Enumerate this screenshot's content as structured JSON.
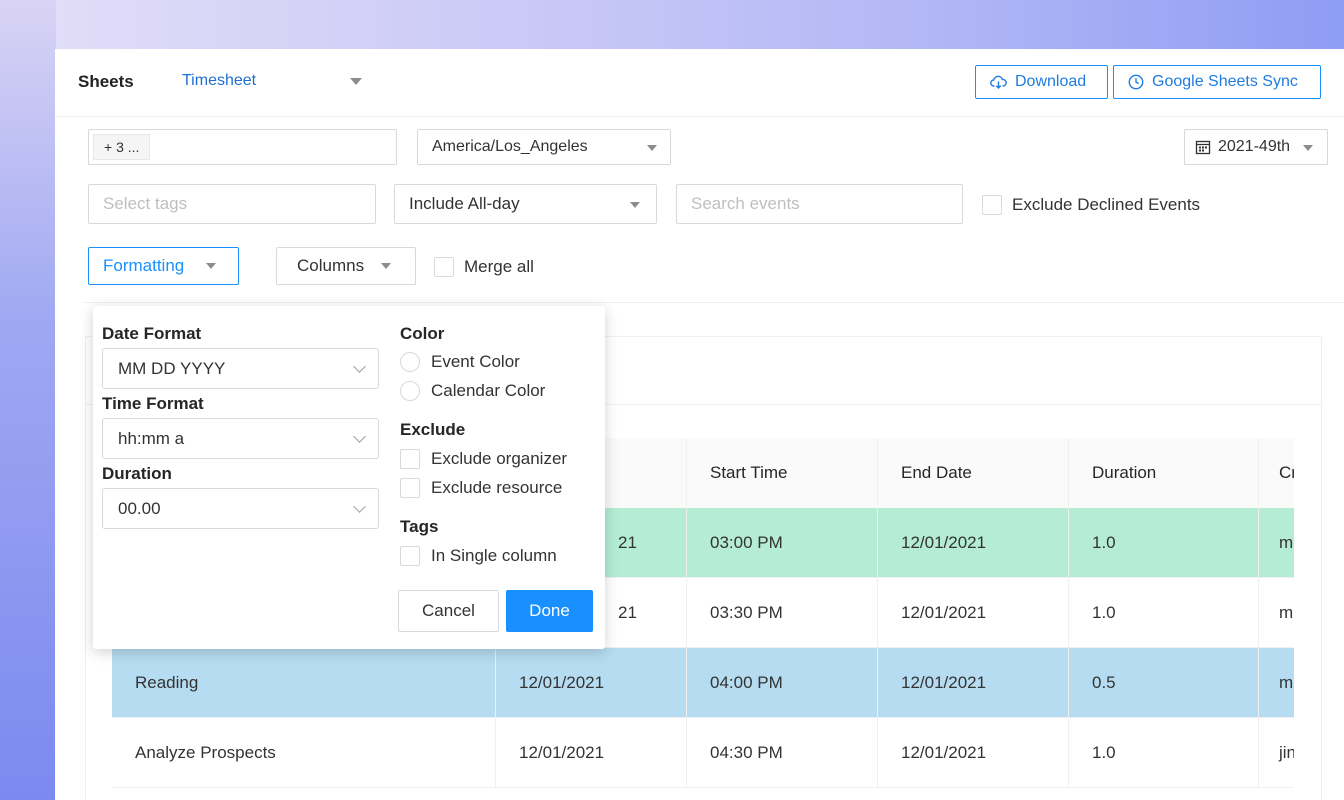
{
  "header": {
    "title": "Sheets",
    "sheet_select": "Timesheet",
    "download_label": "Download",
    "sync_label": "Google Sheets Sync"
  },
  "filters": {
    "calendars_chip": "+ 3 ...",
    "timezone": "America/Los_Angeles",
    "week": "2021-49th",
    "tags_placeholder": "Select tags",
    "allday": "Include All-day",
    "search_placeholder": "Search events",
    "exclude_declined_label": "Exclude Declined Events",
    "formatting_label": "Formatting",
    "columns_label": "Columns",
    "merge_all_label": "Merge all"
  },
  "formatting": {
    "date_format_heading": "Date Format",
    "date_format_value": "MM DD YYYY",
    "time_format_heading": "Time Format",
    "time_format_value": "hh:mm a",
    "duration_heading": "Duration",
    "duration_value": "00.00",
    "color_heading": "Color",
    "event_color": "Event Color",
    "calendar_color": "Calendar Color",
    "exclude_heading": "Exclude",
    "exclude_organizer": "Exclude organizer",
    "exclude_resource": "Exclude resource",
    "tags_heading": "Tags",
    "single_column": "In Single column",
    "cancel_label": "Cancel",
    "done_label": "Done"
  },
  "table": {
    "columns": [
      "",
      "",
      "Start Time",
      "End Date",
      "Duration",
      "Cr"
    ],
    "rows": [
      {
        "title": "",
        "start_date": "21",
        "start_time": "03:00 PM",
        "end_date": "12/01/2021",
        "duration": "1.0",
        "creator": "m",
        "color": "#b4ecd6"
      },
      {
        "title": "",
        "start_date": "21",
        "start_time": "03:30 PM",
        "end_date": "12/01/2021",
        "duration": "1.0",
        "creator": "m",
        "color": "#ffffff"
      },
      {
        "title": "Reading",
        "start_date": "12/01/2021",
        "start_time": "04:00 PM",
        "end_date": "12/01/2021",
        "duration": "0.5",
        "creator": "m",
        "color": "#b5dcf0"
      },
      {
        "title": "Analyze Prospects",
        "start_date": "12/01/2021",
        "start_time": "04:30 PM",
        "end_date": "12/01/2021",
        "duration": "1.0",
        "creator": "jin",
        "color": "#ffffff"
      }
    ]
  },
  "colors": {
    "accent": "#1890ff",
    "row_green": "#b4ecd6",
    "row_blue": "#b5dcf0"
  }
}
